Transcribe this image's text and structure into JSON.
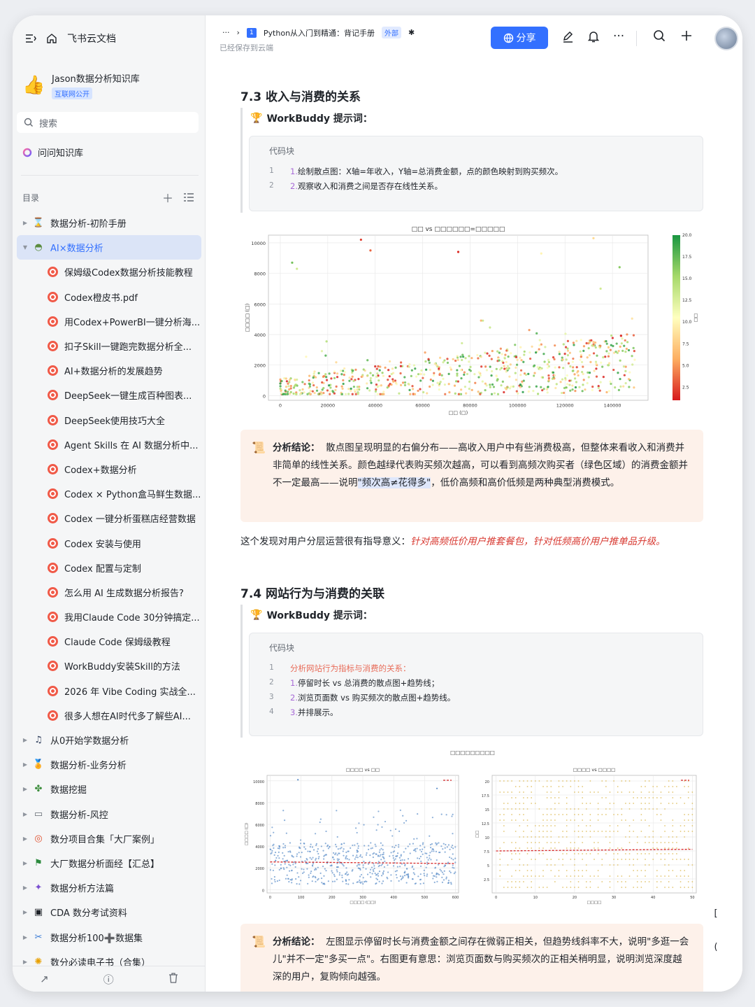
{
  "app": {
    "name": "飞书云文档"
  },
  "knowledge_base": {
    "name": "Jason数据分析知识库",
    "badge": "互联网公开"
  },
  "search": {
    "label": "搜索"
  },
  "ask": {
    "label": "问问知识库"
  },
  "toc": {
    "label": "目录"
  },
  "tree": [
    {
      "label": "数据分析-初阶手册",
      "level": 1,
      "icon": "hourglass-icon",
      "glyph": "⌛",
      "color": "#c0392b"
    },
    {
      "label": "AI×数据分析",
      "level": 1,
      "icon": "ufo-icon",
      "glyph": "◓",
      "color": "#5b8c3e",
      "active": true,
      "expanded": true
    },
    {
      "label": "保姆级Codex数据分析技能教程",
      "level": 2
    },
    {
      "label": "Codex橙皮书.pdf",
      "level": 2
    },
    {
      "label": "用Codex+PowerBI一键分析海...",
      "level": 2
    },
    {
      "label": "扣子Skill一键跑完数据分析全...",
      "level": 2
    },
    {
      "label": "AI+数据分析的发展趋势",
      "level": 2
    },
    {
      "label": "DeepSeek一键生成百种图表...",
      "level": 2
    },
    {
      "label": "DeepSeek使用技巧大全",
      "level": 2
    },
    {
      "label": "Agent Skills 在 AI 数据分析中...",
      "level": 2
    },
    {
      "label": "Codex+数据分析",
      "level": 2
    },
    {
      "label": "Codex × Python盒马鲜生数据...",
      "level": 2
    },
    {
      "label": "Codex 一键分析蛋糕店经营数据",
      "level": 2
    },
    {
      "label": "Codex 安装与使用",
      "level": 2
    },
    {
      "label": "Codex 配置与定制",
      "level": 2
    },
    {
      "label": "怎么用 AI 生成数据分析报告?",
      "level": 2
    },
    {
      "label": "我用Claude Code 30分钟搞定...",
      "level": 2
    },
    {
      "label": "Claude Code 保姆级教程",
      "level": 2
    },
    {
      "label": "WorkBuddy安装Skill的方法",
      "level": 2
    },
    {
      "label": "2026 年 Vibe Coding 实战全...",
      "level": 2
    },
    {
      "label": "很多人想在AI时代多了解些AI...",
      "level": 2
    },
    {
      "label": "从0开始学数据分析",
      "level": 1,
      "icon": "music-note-icon",
      "glyph": "♫",
      "color": "#2f3e5c"
    },
    {
      "label": "数据分析-业务分析",
      "level": 1,
      "icon": "medal-icon",
      "glyph": "🏅",
      "color": "#d9a02c"
    },
    {
      "label": "数据挖掘",
      "level": 1,
      "icon": "puzzle-icon",
      "glyph": "✤",
      "color": "#3f8f3f"
    },
    {
      "label": "数据分析-风控",
      "level": 1,
      "icon": "chat-bubble-icon",
      "glyph": "▭",
      "color": "#646a73"
    },
    {
      "label": "数分项目合集「大厂案例」",
      "level": 1,
      "icon": "target-icon",
      "glyph": "◎",
      "color": "#e0502e"
    },
    {
      "label": "大厂数据分析面经【汇总】",
      "level": 1,
      "icon": "flag-icon",
      "glyph": "⚑",
      "color": "#2c8a3d"
    },
    {
      "label": "数据分析方法篇",
      "level": 1,
      "icon": "sparkle-icon",
      "glyph": "✦",
      "color": "#7a4fd1"
    },
    {
      "label": "CDA 数分考试资料",
      "level": 1,
      "icon": "film-icon",
      "glyph": "▣",
      "color": "#1f2329"
    },
    {
      "label": "数据分析100➕数据集",
      "level": 1,
      "icon": "tools-icon",
      "glyph": "✂",
      "color": "#3a7bd5"
    },
    {
      "label": "数分必读电子书（合集）",
      "level": 1,
      "icon": "sun-icon",
      "glyph": "✺",
      "color": "#e8a000"
    }
  ],
  "doc": {
    "breadcrumb_more": "···",
    "doc_number": "1",
    "title": "Python从入门到精通：背记手册",
    "external_badge": "外部",
    "saved_status": "已经保存到云端",
    "share_label": "分享"
  },
  "section73": {
    "heading": "7.3 收入与消费的关系",
    "prompt_label": "WorkBuddy 提示词：",
    "code_title": "代码块",
    "code_lines": [
      {
        "n": "1",
        "num": "1.",
        "text": "绘制散点图：X轴=年收入，Y轴=总消费金额，点的颜色映射到购买频次。"
      },
      {
        "n": "2",
        "num": "2.",
        "text": "观察收入和消费之间是否存在线性关系。"
      }
    ],
    "conclusion_label": "分析结论：",
    "conclusion_text": "散点图呈现明显的右偏分布——高收入用户中有些消费极高，但整体来看收入和消费并非简单的线性关系。颜色越绿代表购买频次越高，可以看到高频次购买者（绿色区域）的消费金额并不一定最高——说明",
    "conclusion_highlight": "\"频次高≠花得多\"",
    "conclusion_tail": "，低价高频和高价低频是两种典型消费模式。",
    "insight_lead": "这个发现对用户分层运营很有指导意义：",
    "insight_red": "针对高频低价用户推套餐包，针对低频高价用户推单品升级。"
  },
  "section74": {
    "heading": "7.4 网站行为与消费的关联",
    "prompt_label": "WorkBuddy 提示词：",
    "code_title": "代码块",
    "code_lines": [
      {
        "n": "1",
        "num": "",
        "text": "分析网站行为指标与消费的关系：",
        "comment": true
      },
      {
        "n": "2",
        "num": "1.",
        "text": "停留时长 vs 总消费的散点图+趋势线；"
      },
      {
        "n": "3",
        "num": "2.",
        "text": "浏览页面数 vs 购买频次的散点图+趋势线。"
      },
      {
        "n": "4",
        "num": "3.",
        "text": "并排展示。"
      }
    ],
    "conclusion_label": "分析结论：",
    "conclusion_text": "左图显示停留时长与消费金额之间存在微弱正相关，但趋势线斜率不大，说明\"多逛一会儿\"并不一定\"多买一点\"。右图更有意思：浏览页面数与购买频次的正相关稍明显，说明浏览深度越深的用户，复购倾向越强。"
  },
  "chart_data": [
    {
      "type": "scatter",
      "title": "□□ vs □□□□□□=□□□□□",
      "xlabel": "□□ (□)",
      "ylabel": "□□□□ (□)",
      "xlim": [
        -5000,
        155000
      ],
      "ylim": [
        -300,
        10500
      ],
      "xticks": [
        0,
        20000,
        40000,
        60000,
        80000,
        100000,
        120000,
        140000
      ],
      "yticks": [
        0,
        2000,
        4000,
        6000,
        8000,
        10000
      ],
      "colorbar": {
        "min": 1,
        "max": 20,
        "ticks": [
          2.5,
          5.0,
          7.5,
          10.0,
          12.5,
          15.0,
          17.5,
          20.0
        ],
        "label": "□□",
        "colors": [
          "#d7191c",
          "#fdae61",
          "#ffffbf",
          "#a6d96a",
          "#1a9641"
        ]
      },
      "grid": true,
      "series": [
        {
          "n_points": 700,
          "x_range": [
            0,
            150000
          ],
          "y_typical": [
            0,
            5000
          ],
          "outliers": [
            [
              34000,
              10200
            ],
            [
              38000,
              9500
            ],
            [
              75000,
              9400
            ],
            [
              132000,
              10300
            ],
            [
              5000,
              8700
            ],
            [
              110000,
              9300
            ],
            [
              143000,
              8400
            ],
            [
              7000,
              8300
            ],
            [
              135000,
              7000
            ]
          ]
        }
      ]
    },
    {
      "type": "scatter",
      "suptitle": "□□□□□□□□□",
      "title": "□□□□ vs □□",
      "xlabel": "□□□□ (□□)",
      "ylabel": "□□□□ (□)",
      "xlim": [
        -10,
        610
      ],
      "ylim": [
        -300,
        10500
      ],
      "xticks": [
        0,
        100,
        200,
        300,
        400,
        500,
        600
      ],
      "yticks": [
        0,
        2000,
        4000,
        6000,
        8000,
        10000
      ],
      "grid": true,
      "series": [
        {
          "n_points": 600,
          "color": "#5d8ec9",
          "trend_line": {
            "x": [
              0,
              600
            ],
            "y": [
              2550,
              2400
            ],
            "color": "#d62728"
          }
        }
      ]
    },
    {
      "type": "scatter",
      "title": "□□□□ vs □□□□",
      "xlabel": "□□□□",
      "ylabel": "□□",
      "xlim": [
        -1,
        51
      ],
      "ylim": [
        0,
        21
      ],
      "xticks": [
        0,
        10,
        20,
        30,
        40,
        50
      ],
      "yticks": [
        2.5,
        5.0,
        7.5,
        10.0,
        12.5,
        15.0,
        17.5,
        20.0
      ],
      "grid": true,
      "series": [
        {
          "grid_points": true,
          "color": "#d8b13f",
          "trend_line": {
            "x": [
              0,
              50
            ],
            "y": [
              7.5,
              7.8
            ],
            "color": "#d62728"
          }
        }
      ]
    }
  ]
}
